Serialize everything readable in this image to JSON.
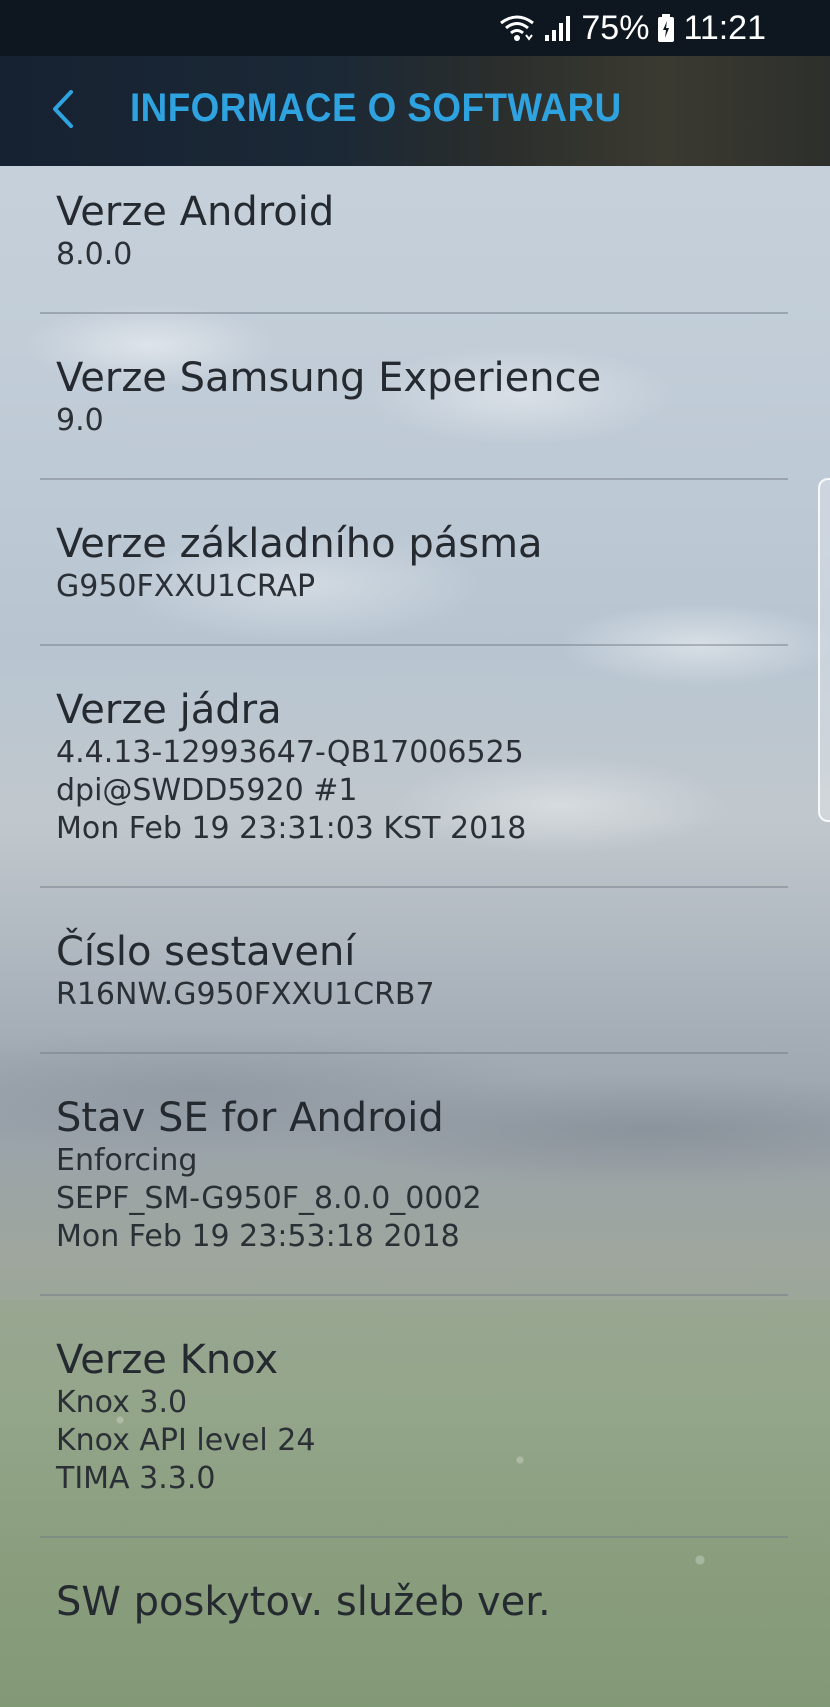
{
  "status_bar": {
    "battery": "75%",
    "time": "11:21",
    "icons": [
      "wifi-icon",
      "signal-icon",
      "battery-icon"
    ]
  },
  "header": {
    "title": "INFORMACE O SOFTWARU",
    "back_icon": "chevron-left-icon",
    "accent_color": "#2ea3e0"
  },
  "items": [
    {
      "title": "Verze Android",
      "values": [
        "8.0.0"
      ]
    },
    {
      "title": "Verze Samsung Experience",
      "values": [
        "9.0"
      ]
    },
    {
      "title": "Verze základního pásma",
      "values": [
        "G950FXXU1CRAP"
      ]
    },
    {
      "title": "Verze jádra",
      "values": [
        "4.4.13-12993647-QB17006525",
        "dpi@SWDD5920 #1",
        "Mon Feb 19 23:31:03 KST 2018"
      ]
    },
    {
      "title": "Číslo sestavení",
      "values": [
        "R16NW.G950FXXU1CRB7"
      ]
    },
    {
      "title": "Stav SE for Android",
      "values": [
        "Enforcing",
        "SEPF_SM-G950F_8.0.0_0002",
        "Mon Feb 19 23:53:18 2018"
      ]
    },
    {
      "title": "Verze Knox",
      "values": [
        "Knox 3.0",
        "Knox API level 24",
        "TIMA 3.3.0"
      ]
    },
    {
      "title": "SW poskytov. služeb ver.",
      "values": []
    }
  ]
}
